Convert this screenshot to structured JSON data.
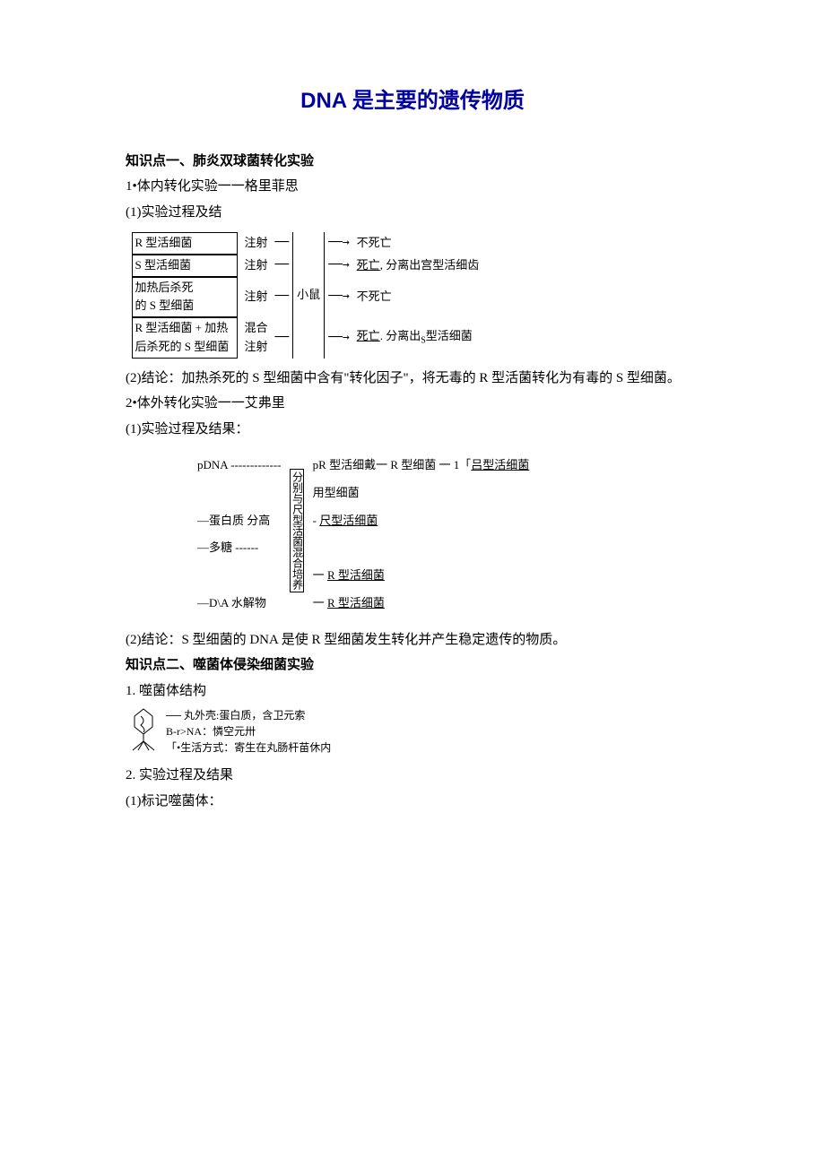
{
  "title": "DNA 是主要的遗传物质",
  "kp1": {
    "heading": "知识点一、肺炎双球菌转化实验",
    "exp1": {
      "title": "1•体内转化实验一一格里菲思",
      "step_label": "(1)实验过程及结",
      "rows": [
        {
          "box": "R 型活细菌",
          "inj": "注射",
          "result": "不死亡"
        },
        {
          "box": "S 型活细菌",
          "inj": "注射",
          "result_pre": "死亡",
          "result_suf": ", 分离出宫型活细齿"
        },
        {
          "box": "加热后杀死\n的 S 型细菌",
          "inj": "注射",
          "mid": "小鼠",
          "result": "不死亡"
        },
        {
          "box": "R 型活细菌 + 加热\n后杀死的 S 型细菌",
          "inj": "混合\n注射",
          "result_pre": "死亡",
          "result_suf": ". 分离出",
          "result_sub": "S",
          "result_end": "型活细菌"
        }
      ],
      "conclusion": "(2)结论：加热杀死的 S 型细菌中含有\"转化因子\"，将无毒的 R 型活菌转化为有毒的 S 型细菌。"
    },
    "exp2": {
      "title": "2•体外转化实验一一艾弗里",
      "step_label": "(1)实验过程及结果：",
      "left": [
        "pDNA -------------",
        "—蛋白质  分高",
        "—多糖 ------",
        "—D\\A 水解物"
      ],
      "mid_label": "分别与尺型活菌混合培养",
      "right": [
        "pR 型活细戴一 R 型细菌  一 1「",
        "吕型活细菌",
        "用型细菌",
        "尺型活细菌",
        "R 型活细菌",
        "R 型活细菌"
      ],
      "conclusion": "(2)结论：S 型细菌的 DNA 是使 R 型细菌发生转化并产生稳定遗传的物质。"
    }
  },
  "kp2": {
    "heading": "知识点二、噬菌体侵染细菌实验",
    "s1": {
      "title": "1.  噬菌体结构",
      "lines": [
        "丸外壳:蛋白质，含卫元索",
        "B-r>NA：憐空元卅",
        "「•生活方式：寄生在丸肠杆苗休内"
      ]
    },
    "s2": "2.  实验过程及结果",
    "s3": "(1)标记噬菌体："
  }
}
